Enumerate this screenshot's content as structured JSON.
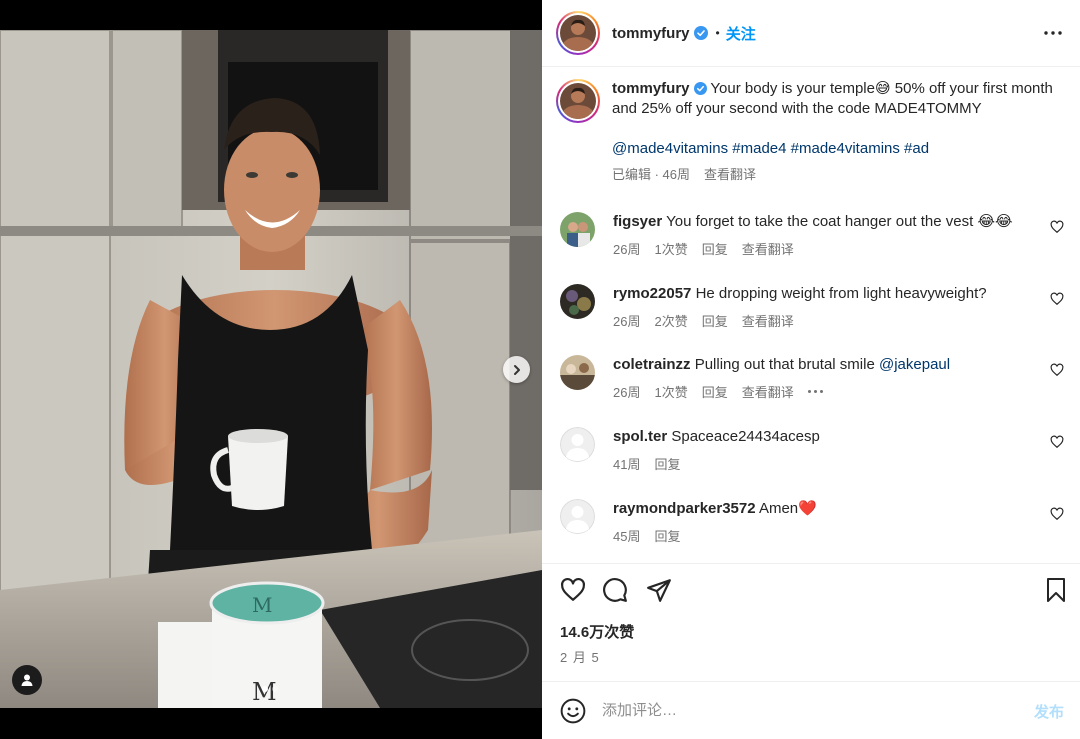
{
  "post": {
    "author": "tommyfury",
    "follow_label": "关注",
    "bullet": "•",
    "caption_text": "Your body is your temple😅 50% off your first month and 25% off your second with the code MADE4TOMMY",
    "hashtags": "@made4vitamins #made4 #made4vitamins #ad",
    "edited_label": "已编辑 · 46周",
    "translate_label": "查看翻译",
    "likes": "14.6万次赞",
    "date": "2 月 5",
    "comment_placeholder": "添加评论…",
    "post_button": "发布"
  },
  "comments": [
    {
      "user": "figsyer",
      "text": "You forget to take the coat hanger out the vest 😂😂",
      "time": "26周",
      "likes": "1次赞",
      "reply": "回复",
      "translate": "查看翻译"
    },
    {
      "user": "rymo22057",
      "text": "He dropping weight from light heavyweight?",
      "time": "26周",
      "likes": "2次赞",
      "reply": "回复",
      "translate": "查看翻译"
    },
    {
      "user": "coletrainzz",
      "text": "Pulling out that brutal smile",
      "mention": "@jakepaul",
      "time": "26周",
      "likes": "1次赞",
      "reply": "回复",
      "translate": "查看翻译"
    },
    {
      "user": "spol.ter",
      "text": "Spaceace24434acesp",
      "time": "41周",
      "reply": "回复"
    },
    {
      "user": "raymondparker3572",
      "text": "Amen❤️",
      "time": "45周",
      "reply": "回复"
    }
  ],
  "colors": {
    "link_blue": "#0095f6",
    "hashtag_navy": "#00376b",
    "muted_gray": "#737373",
    "disabled_post": "#b2dffc"
  },
  "icons": [
    "verified-icon",
    "more-options-icon",
    "heart-icon",
    "comment-icon",
    "share-icon",
    "bookmark-icon",
    "emoji-icon",
    "chevron-right-icon",
    "person-tag-icon"
  ],
  "carousel": {
    "slides": 2,
    "active": 1
  }
}
